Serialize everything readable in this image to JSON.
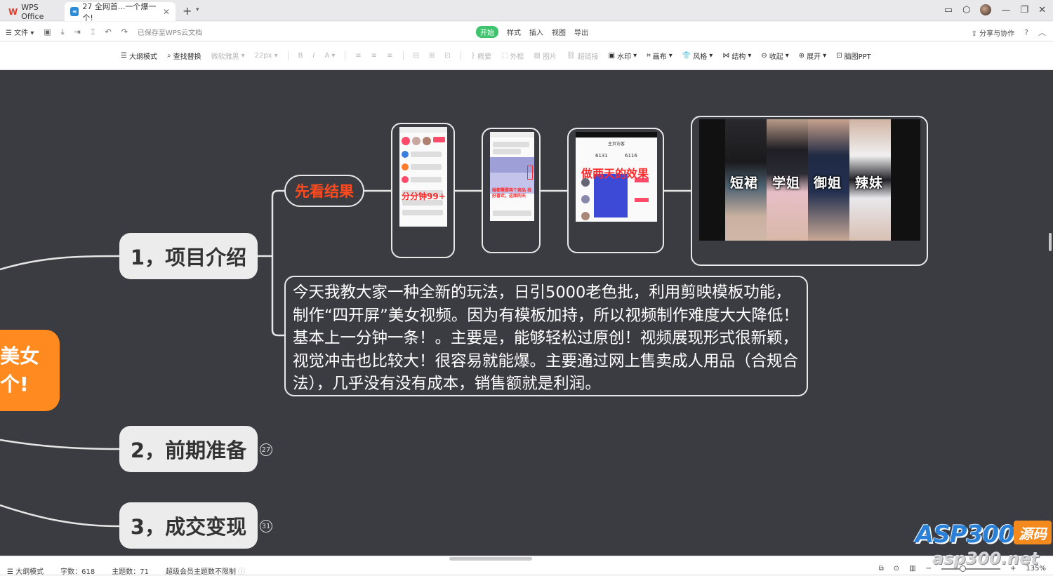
{
  "titlebar": {
    "app_tab": "WPS Office",
    "doc_tab": "27 全网首...一个爆一个!",
    "doc_badge": "≡"
  },
  "menubar": {
    "file": "文件",
    "saved_status": "已保存至WPS云文档",
    "tabs": [
      "开始",
      "样式",
      "插入",
      "视图",
      "导出"
    ],
    "active_tab": "开始",
    "share": "分享与协作"
  },
  "toolbar": {
    "outline_mode": "大纲模式",
    "find_replace": "查找替换",
    "font_name": "微软雅黑",
    "font_size": "22px",
    "bold": "B",
    "italic": "I",
    "font_color": "A",
    "summary": "概要",
    "frame": "外框",
    "image": "图片",
    "hyperlink": "超链接",
    "watermark": "水印",
    "layout": "画布",
    "style": "风格",
    "structure": "结构",
    "collapse": "收起",
    "expand": "展开",
    "ppt": "脑图PPT"
  },
  "mindmap": {
    "root": {
      "line1": "美女",
      "line2": "个!",
      "color": "#ff8a1f"
    },
    "branches": [
      {
        "label": "1，项目介绍"
      },
      {
        "label": "2，前期准备",
        "count": "27"
      },
      {
        "label": "3，成交变现",
        "count": "31"
      }
    ],
    "result_node": "先看结果",
    "phone1_overlay": "分分钟99+",
    "phone2_overlay": "碰都需要两个商品 我好喜欢，这面的天",
    "phone3": {
      "header": "主页访客",
      "stat1": "6131",
      "stat2": "6116",
      "overlay": "做两天的效果"
    },
    "video_labels": [
      "短裙",
      "学姐",
      "御姐",
      "辣妹"
    ],
    "description": "今天我教大家一种全新的玩法，日引5000老色批，利用剪映模板功能，制作“四开屏”美女视频。因为有模板加持，所以视频制作难度大大降低！基本上一分钟一条！。主要是，能够轻松过原创！视频展现形式很新颖，视觉冲击也比较大！很容易就能爆。主要通过网上售卖成人用品（合规合法），几乎没有没有成本，销售额就是利润。"
  },
  "statusbar": {
    "mode": "大纲模式",
    "word_count": "字数：618",
    "topic_count": "主题数：71",
    "member_note": "超级会员主题数不限制",
    "zoom": "135%"
  },
  "watermark": {
    "brand": "ASP300",
    "badge": "源码",
    "domain": "asp300.net"
  },
  "colors": {
    "canvas": "#3a3c41",
    "accent_orange": "#ff8a1f",
    "accent_red": "#ff4a1f",
    "active_green": "#3ec46d"
  }
}
